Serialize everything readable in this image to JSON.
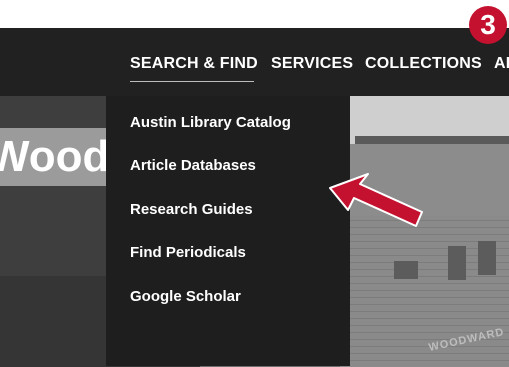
{
  "step_badge": "3",
  "nav": {
    "items": [
      {
        "label": "SEARCH & FIND"
      },
      {
        "label": "SERVICES"
      },
      {
        "label": "COLLECTIONS"
      },
      {
        "label": "AB"
      }
    ]
  },
  "dropdown": {
    "items": [
      {
        "label": "Austin Library Catalog"
      },
      {
        "label": "Article Databases"
      },
      {
        "label": "Research Guides"
      },
      {
        "label": "Find Periodicals"
      },
      {
        "label": "Google Scholar"
      }
    ]
  },
  "hero": {
    "wordmark": "Woodw",
    "building_sign": "WOODWARD"
  },
  "colors": {
    "navbar": "#212121",
    "dropdown": "#1e1e1e",
    "accent_red": "#c4112f"
  },
  "icons": {
    "pointer": "arrow-pointer-icon"
  }
}
